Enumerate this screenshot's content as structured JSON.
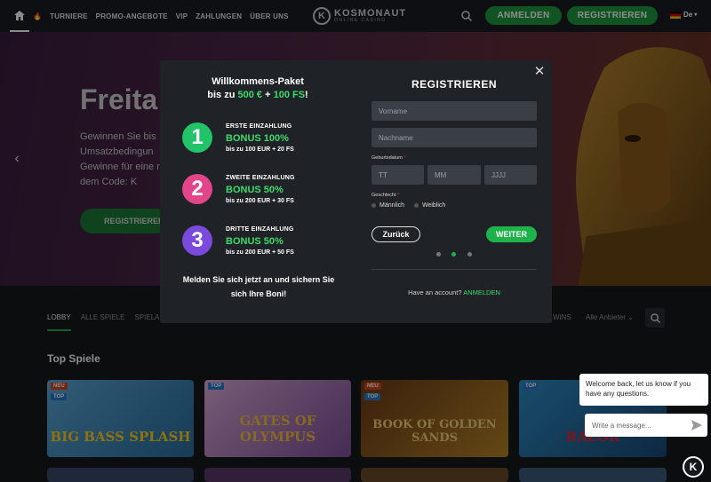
{
  "nav": {
    "links": [
      "TURNIERE",
      "PROMO-ANGEBOTE",
      "VIP",
      "ZAHLUNGEN",
      "ÜBER UNS"
    ],
    "logo_title": "KOSMONAUT",
    "logo_subtitle": "ONLINE CASINO",
    "login_label": "ANMELDEN",
    "register_label": "REGISTRIEREN",
    "language": "De"
  },
  "hero": {
    "title": "Freita",
    "text": "Gewinnen Sie bis Umsatzbedingun Gewinne für eine mit dem Code: K",
    "button": "REGISTRIEREN"
  },
  "tabs": {
    "left": [
      "LOBBY",
      "ALLE SPIELE",
      "SPIELA"
    ],
    "right_wins": "WINS",
    "providers": "Alle Anbieter"
  },
  "section_title": "Top Spiele",
  "games": [
    {
      "badge": "NEU",
      "badge2": "TOP",
      "title": "BIG BASS SPLASH"
    },
    {
      "badge": "",
      "badge2": "TOP",
      "title": "GATES OF OLYMPUS"
    },
    {
      "badge": "NEU",
      "badge2": "TOP",
      "title": "BOOK OF GOLDEN SANDS"
    },
    {
      "badge": "",
      "badge2": "TOP",
      "title": "RAZOR"
    }
  ],
  "modal": {
    "welcome_line1": "Willkommens-Paket",
    "welcome_line2_a": "bis zu ",
    "welcome_line2_b": "500 €",
    "welcome_line2_c": " + ",
    "welcome_line2_d": "100 FS",
    "welcome_line2_e": "!",
    "bonuses": [
      {
        "number": "1",
        "label": "ERSTE EINZAHLUNG",
        "bonus": "BONUS 100%",
        "sub": "bis zu 100 EUR + 20 FS"
      },
      {
        "number": "2",
        "label": "ZWEITE EINZAHLUNG",
        "bonus": "BONUS 50%",
        "sub": "bis zu 200 EUR + 30 FS"
      },
      {
        "number": "3",
        "label": "DRITTE EINZAHLUNG",
        "bonus": "BONUS 50%",
        "sub": "bis zu 200 EUR + 50 FS"
      }
    ],
    "footer_line1": "Melden Sie sich jetzt an und sichern Sie",
    "footer_line2": "sich Ihre Boni!",
    "reg_title": "REGISTRIEREN",
    "first_name_placeholder": "Vorname",
    "last_name_placeholder": "Nachname",
    "dob_label": "Geburtsdatum",
    "day_placeholder": "TT",
    "month_placeholder": "MM",
    "year_placeholder": "JJJJ",
    "gender_label": "Geschlecht",
    "male": "Männlich",
    "female": "Weiblich",
    "back_label": "Zurück",
    "next_label": "WEITER",
    "have_account": "Have an account?",
    "login_link": "ANMELDEN",
    "step_current": 2,
    "step_total": 3
  },
  "chat": {
    "message": "Welcome back, let us know if you have any questions.",
    "input_placeholder": "Write a message..."
  },
  "colors": {
    "accent_green": "#1eb24a",
    "bonus_green": "#3ddc6a",
    "modal_bg": "#1f2226"
  }
}
